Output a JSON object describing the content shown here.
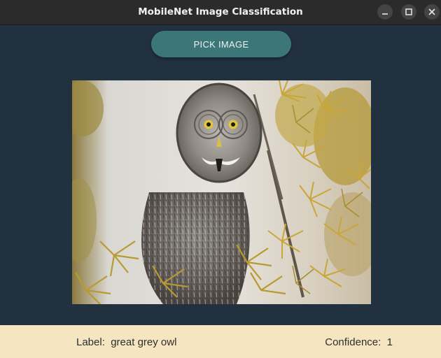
{
  "window": {
    "title": "MobileNet Image Classification"
  },
  "controls": {
    "minimize_icon": "minimize-icon",
    "maximize_icon": "maximize-icon",
    "close_icon": "close-icon"
  },
  "main": {
    "pick_button_label": "PICK IMAGE",
    "image_subject": "great grey owl on pine branches"
  },
  "result": {
    "label_caption": "Label:",
    "label_value": "great grey owl",
    "confidence_caption": "Confidence:",
    "confidence_value": "1"
  },
  "colors": {
    "background": "#22313f",
    "button": "#3c7679",
    "footer": "#f5e5c0",
    "titlebar": "#2b2b2b"
  }
}
